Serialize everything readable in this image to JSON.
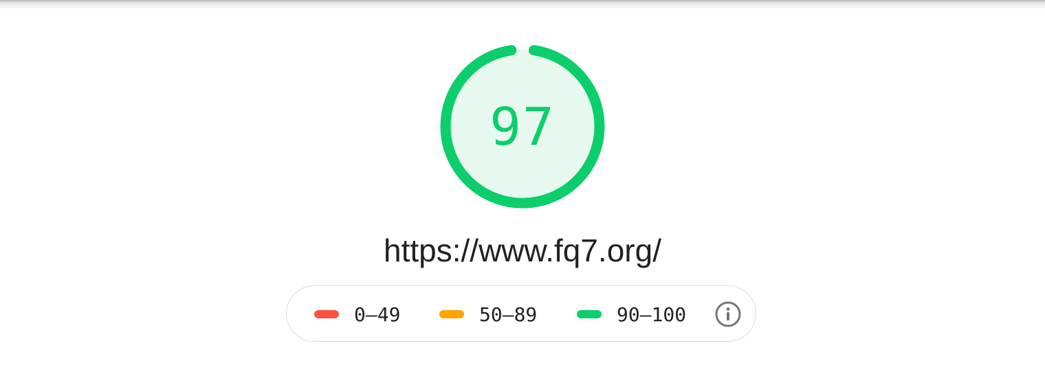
{
  "report": {
    "score": "97",
    "score_fraction": 0.97,
    "url": "https://www.fq7.org/"
  },
  "colors": {
    "pass": "#0cce6b",
    "pass_fill": "#e7f8ee",
    "average": "#ffa400",
    "fail": "#ff4e42"
  },
  "legend": {
    "items": [
      {
        "label": "0–49",
        "color": "#ff4e42"
      },
      {
        "label": "50–89",
        "color": "#ffa400"
      },
      {
        "label": "90–100",
        "color": "#0cce6b"
      }
    ],
    "info_icon": "info-icon"
  }
}
